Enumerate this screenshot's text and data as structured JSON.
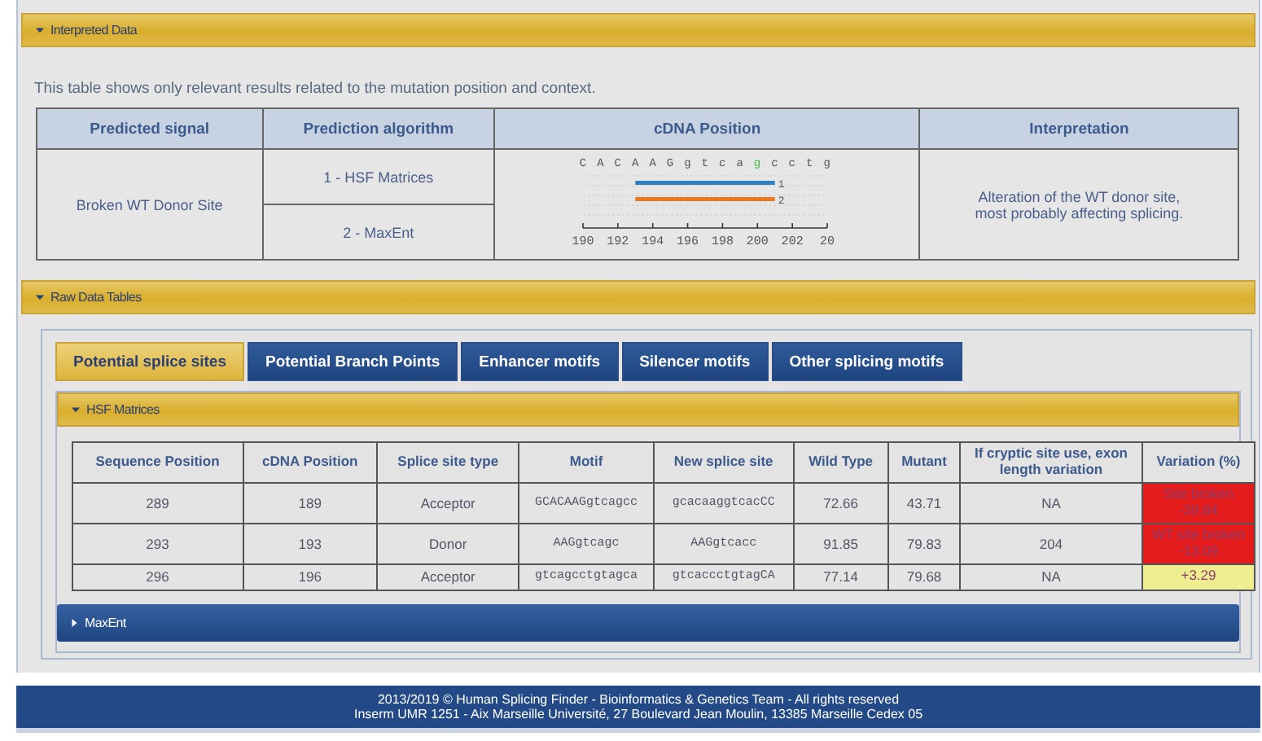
{
  "interpreted": {
    "title": "Interpreted Data",
    "expanded": true,
    "intro": "This table shows only relevant results related to the mutation position and context.",
    "columns": [
      "Predicted signal",
      "Prediction algorithm",
      "cDNA Position",
      "Interpretation"
    ],
    "signal": "Broken WT Donor Site",
    "algorithms": [
      "1 - HSF Matrices",
      "2 - MaxEnt"
    ],
    "sequence": [
      {
        "letter": "C",
        "mutated": false
      },
      {
        "letter": "A",
        "mutated": false
      },
      {
        "letter": "C",
        "mutated": false
      },
      {
        "letter": "A",
        "mutated": false
      },
      {
        "letter": "A",
        "mutated": false
      },
      {
        "letter": "G",
        "mutated": false
      },
      {
        "letter": "g",
        "mutated": false
      },
      {
        "letter": "t",
        "mutated": false
      },
      {
        "letter": "c",
        "mutated": false
      },
      {
        "letter": "a",
        "mutated": false
      },
      {
        "letter": "g",
        "mutated": true
      },
      {
        "letter": "c",
        "mutated": false
      },
      {
        "letter": "c",
        "mutated": false
      },
      {
        "letter": "t",
        "mutated": false
      },
      {
        "letter": "g",
        "mutated": false
      }
    ],
    "tracks": [
      {
        "label": "1",
        "color": "#2f7fc1"
      },
      {
        "label": "2",
        "color": "#e87722"
      }
    ],
    "scale_labels": [
      "190",
      "192",
      "194",
      "196",
      "198",
      "200",
      "202",
      "20"
    ],
    "interpretation": [
      "Alteration of the WT donor site,",
      "most probably affecting splicing."
    ]
  },
  "raw": {
    "title": "Raw Data Tables",
    "expanded": true,
    "tabs": [
      {
        "label": "Potential splice sites",
        "selected": true
      },
      {
        "label": "Potential Branch Points",
        "selected": false
      },
      {
        "label": "Enhancer motifs",
        "selected": false
      },
      {
        "label": "Silencer motifs",
        "selected": false
      },
      {
        "label": "Other splicing motifs",
        "selected": false
      }
    ],
    "hsf": {
      "title": "HSF Matrices",
      "expanded": true,
      "columns": [
        "Sequence Position",
        "cDNA Position",
        "Splice site type",
        "Motif",
        "New splice site",
        "Wild Type",
        "Mutant",
        "If cryptic site use, exon length variation",
        "Variation (%)"
      ],
      "rows": [
        {
          "cells": [
            "289",
            "189",
            "Acceptor",
            "GCACAAGgtcagcc",
            "gcacaaggtcacCC",
            "72.66",
            "43.71",
            "NA"
          ],
          "variation": [
            "Site broken",
            "-39.84"
          ],
          "color": "#e31b1b"
        },
        {
          "cells": [
            "293",
            "193",
            "Donor",
            "AAGgtcagc",
            "AAGgtcacc",
            "91.85",
            "79.83",
            "204"
          ],
          "variation": [
            "WT site broken",
            "-13.09"
          ],
          "color": "#e31b1b"
        },
        {
          "cells": [
            "296",
            "196",
            "Acceptor",
            "gtcagcctgtagca",
            "gtcaccctgtagCA",
            "77.14",
            "79.68",
            "NA"
          ],
          "variation": [
            "+3.29"
          ],
          "color": "#eeee90"
        }
      ]
    },
    "maxent": {
      "title": "MaxEnt",
      "expanded": false
    }
  },
  "footer": [
    "2013/2019 © Human Splicing Finder - Bioinformatics & Genetics Team - All rights reserved",
    "Inserm UMR 1251 - Aix Marseille Université, 27 Boulevard Jean Moulin, 13385 Marseille Cedex 05"
  ]
}
